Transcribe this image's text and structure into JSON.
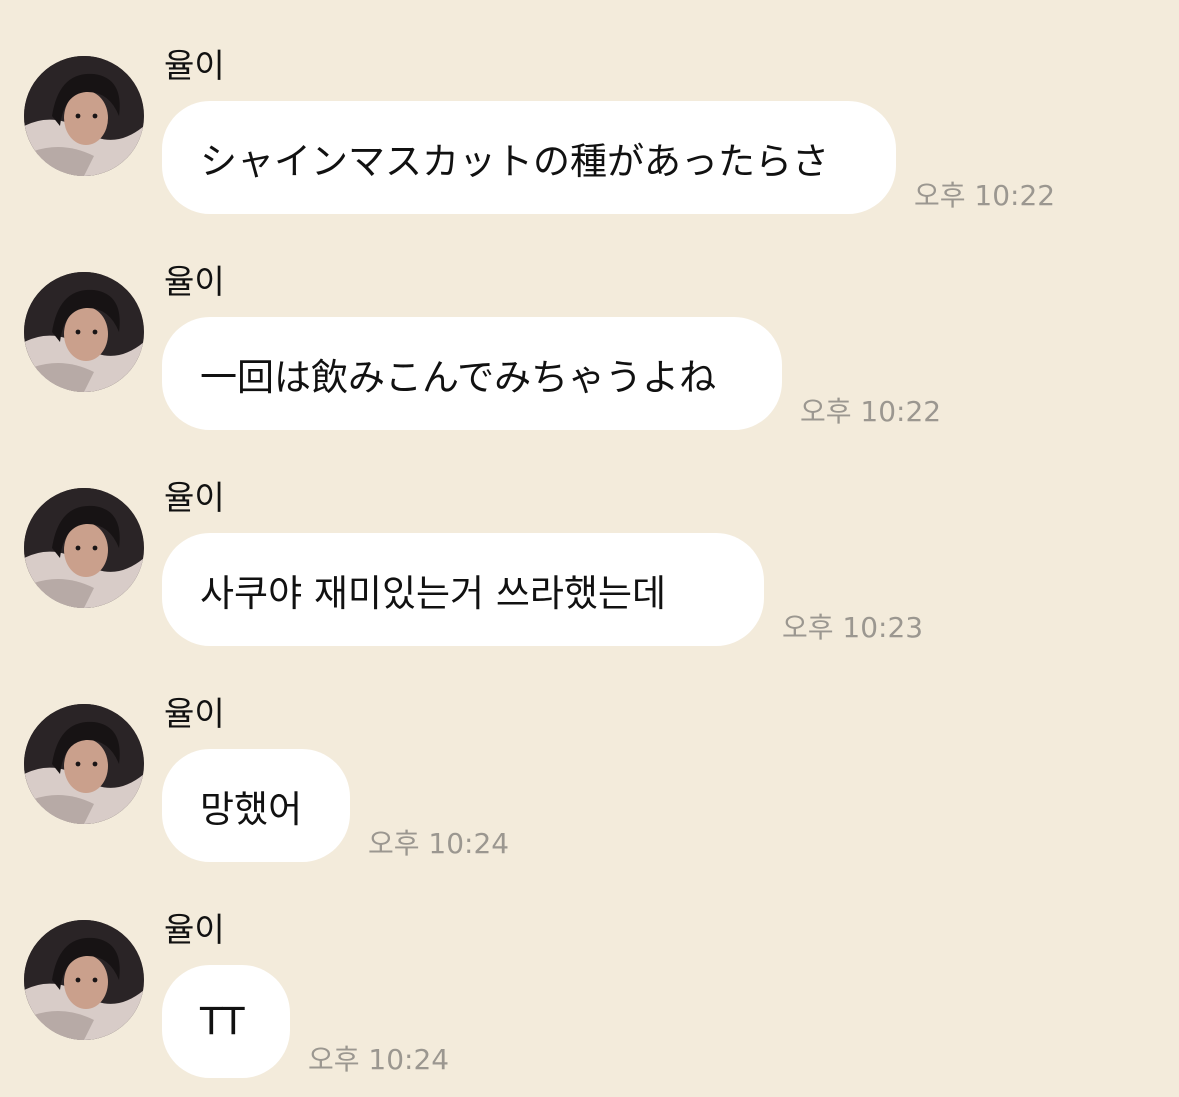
{
  "chat": {
    "messages": [
      {
        "sender": "율이",
        "text": "シャインマスカットの種があったらさ",
        "time": "오후 10:22"
      },
      {
        "sender": "율이",
        "text": "一回は飲みこんでみちゃうよね",
        "time": "오후 10:22"
      },
      {
        "sender": "율이",
        "text": "사쿠야 재미있는거 쓰라했는데",
        "time": "오후 10:23"
      },
      {
        "sender": "율이",
        "text": "망했어",
        "time": "오후 10:24"
      },
      {
        "sender": "율이",
        "text": "TT",
        "time": "오후 10:24"
      }
    ]
  },
  "colors": {
    "background": "#f3ebdb",
    "bubble": "#ffffff",
    "time_text": "#9b9790"
  }
}
